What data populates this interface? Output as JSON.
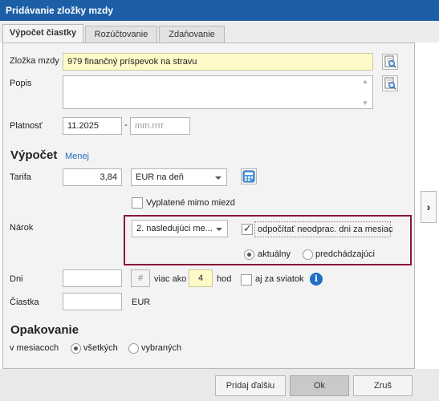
{
  "window": {
    "title": "Pridávanie zložky mzdy"
  },
  "tabs": [
    {
      "label": "Výpočet čiastky",
      "active": true
    },
    {
      "label": "Rozúčtovanie",
      "active": false
    },
    {
      "label": "Zdaňovanie",
      "active": false
    }
  ],
  "form": {
    "zlozka_label": "Zložka mzdy",
    "zlozka_value": "979  finančný príspevok na stravu",
    "popis_label": "Popis",
    "popis_value": "",
    "platnost_label": "Platnosť",
    "platnost_from": "11.2025",
    "platnost_sep": "-",
    "platnost_to_placeholder": "mm.rrrr"
  },
  "vypocet": {
    "heading": "Výpočet",
    "less_link": "Menej",
    "tarifa_label": "Tarifa",
    "tarifa_value": "3,84",
    "tarifa_unit": "EUR na deň",
    "vyplatene_label": "Vyplatené mimo miezd",
    "vyplatene_checked": false,
    "narok_label": "Nárok",
    "narok_value": "2. nasledujúci me...",
    "odpocitat_label": "odpočítať neodprac. dni za mesiac",
    "odpocitat_checked": true,
    "radio_aktualny": "aktuálny",
    "radio_predchadzajuci": "predchádzajúci",
    "radio_selected": "aktualny",
    "dni_label": "Dni",
    "dni_value": "",
    "hash_symbol": "#",
    "viac_ako": "viac ako",
    "hod_value": "4",
    "hod_label": "hod",
    "aj_za_sviatok": "aj za sviatok",
    "aj_za_sviatok_checked": false,
    "ciastka_label": "Čiastka",
    "ciastka_value": "",
    "ciastka_unit": "EUR"
  },
  "opakovanie": {
    "heading": "Opakovanie",
    "v_mesiacoch_label": "v mesiacoch",
    "option_vsetkych": "všetkých",
    "option_vybranych": "vybraných",
    "selected": "vsetkych"
  },
  "footer": {
    "pridaj_dalsiu": "Pridaj ďalšiu",
    "ok": "Ok",
    "zrus": "Zruš"
  },
  "colors": {
    "titlebar": "#1d5fa6",
    "highlight_frame": "#8a1538",
    "input_yellow": "#fffbc9",
    "link": "#1f6fc4",
    "info": "#1f6fc4"
  }
}
